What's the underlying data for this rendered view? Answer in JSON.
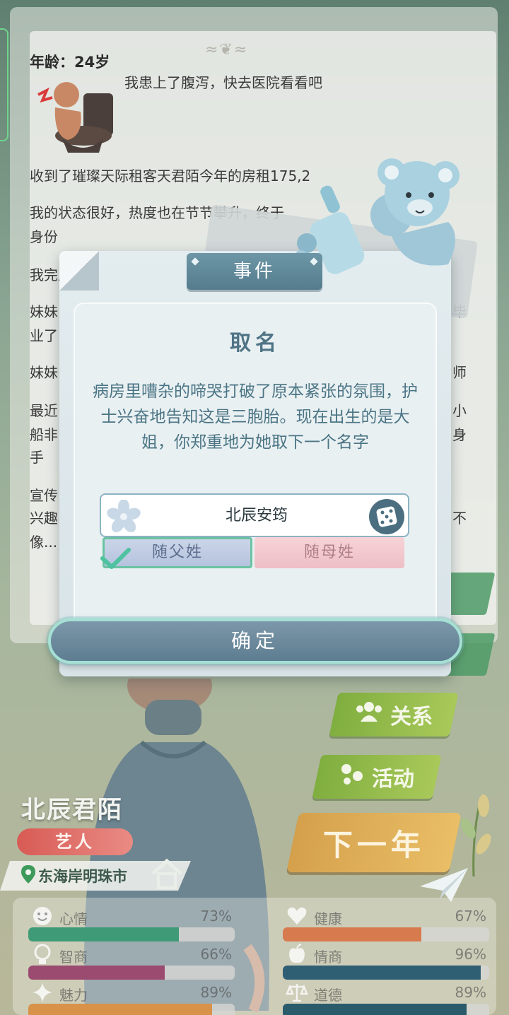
{
  "log": {
    "age": "年龄：24岁",
    "lines": [
      "我患上了腹泻，快去医院看看吧",
      "收到了璀璨天际租客天君陌今年的房租175,2",
      "我的状态很好，热度也在节节攀升，终于",
      "身份",
      "我完成",
      "妹妹",
      "业了",
      "妹妹",
      "最近",
      "船非",
      "手",
      "宣传",
      "兴趣",
      "像..."
    ],
    "right_fragments": [
      "毕",
      "师",
      "小",
      "身",
      "不"
    ]
  },
  "modal": {
    "header": "事件",
    "title": "取名",
    "description": "病房里嘈杂的啼哭打破了原本紧张的氛围，护士兴奋地告知这是三胞胎。现在出生的是大姐，你郑重地为她取下一个名字",
    "name_value": "北辰安筠",
    "father_label": "随父姓",
    "mother_label": "随母姓",
    "confirm_label": "确定"
  },
  "side_buttons": {
    "relation": "关系",
    "activity": "活动",
    "next_year": "下一年"
  },
  "character": {
    "name": "北辰君陌",
    "job": "艺人",
    "location": "东海岸明珠市"
  },
  "stats": [
    {
      "name": "心情",
      "value": 73,
      "label": "73%",
      "color": "#3f9b77",
      "icon": "smile-icon"
    },
    {
      "name": "健康",
      "value": 67,
      "label": "67%",
      "color": "#d77b4f",
      "icon": "heart-icon"
    },
    {
      "name": "智商",
      "value": 66,
      "label": "66%",
      "color": "#9a4b6f",
      "icon": "bulb-icon"
    },
    {
      "name": "情商",
      "value": 96,
      "label": "96%",
      "color": "#2f5f73",
      "icon": "apple-icon"
    },
    {
      "name": "魅力",
      "value": 89,
      "label": "89%",
      "color": "#d9924a",
      "icon": "sparkle-icon"
    },
    {
      "name": "道德",
      "value": 89,
      "label": "89%",
      "color": "#2a5b6b",
      "icon": "scale-icon"
    }
  ]
}
